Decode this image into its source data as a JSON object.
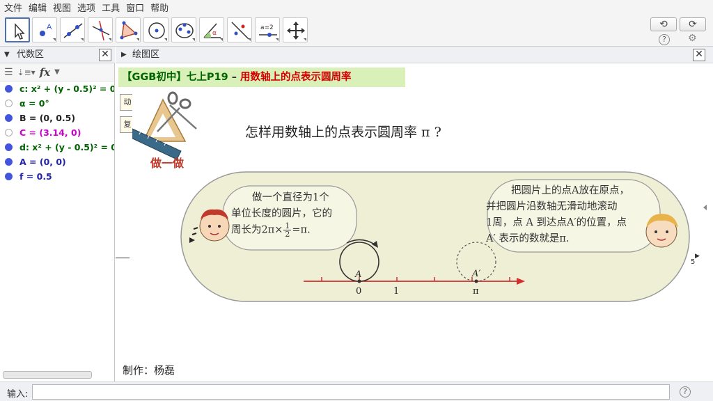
{
  "menu": [
    "文件",
    "编辑",
    "视图",
    "选项",
    "工具",
    "窗口",
    "帮助"
  ],
  "toolbar": {
    "tools": [
      "move-tool-icon",
      "point-tool-icon",
      "line-tool-icon",
      "perpendicular-tool-icon",
      "polygon-tool-icon",
      "circle-tool-icon",
      "ellipse-tool-icon",
      "angle-tool-icon",
      "reflect-tool-icon",
      "slider-tool-icon",
      "move-view-tool-icon"
    ],
    "slider_icon_text": "a=2",
    "undo": "⟲",
    "redo": "⟳",
    "help": "?",
    "settings": "⚙"
  },
  "algebra": {
    "title": "代数区",
    "fx": "fx",
    "items": [
      {
        "text": "c: x² + (y - 0.5)² = 0.",
        "color": "#006400",
        "dot": "#4455dd",
        "filled": true
      },
      {
        "text": "α = 0°",
        "color": "#006400",
        "dot": "#aaaaaa",
        "filled": false
      },
      {
        "text": "B = (0, 0.5)",
        "color": "#222222",
        "dot": "#4455dd",
        "filled": true
      },
      {
        "text": "C = (3.14, 0)",
        "color": "#cc00cc",
        "dot": "#aaaaaa",
        "filled": false
      },
      {
        "text": "d: x² + (y - 0.5)² = 0.",
        "color": "#006400",
        "dot": "#4455dd",
        "filled": true
      },
      {
        "text": "A = (0, 0)",
        "color": "#2222aa",
        "dot": "#4455dd",
        "filled": true
      },
      {
        "text": "f = 0.5",
        "color": "#2222aa",
        "dot": "#4455dd",
        "filled": true
      }
    ]
  },
  "graphics": {
    "title": "绘图区",
    "banner_prefix": "【GGB初中】七上P19",
    "banner_dash": " – ",
    "banner_topic": "用数轴上的点表示圆周率",
    "button_1": "动",
    "button_2": "复",
    "activity_label": "做一做",
    "question": "怎样用数轴上的点表示圆周率 π ?",
    "left_bubble": [
      "做一个直径为1个",
      "单位长度的圆片，它的",
      "周长为2π×",
      "=π."
    ],
    "fraction_num": "1",
    "fraction_den": "2",
    "right_bubble": [
      "把圆片上的点A放在原点，",
      "并把圆片沿数轴无滑动地滚动",
      "1周，点 A 到达点A′的位置，点",
      "A′ 表示的数就是π."
    ],
    "point_a": "A",
    "point_a_prime": "A′",
    "tick_0": "0",
    "tick_1": "1",
    "tick_pi": "π",
    "axis_5": "5",
    "credit": "制作：杨磊"
  },
  "input": {
    "label": "输入:",
    "value": ""
  }
}
